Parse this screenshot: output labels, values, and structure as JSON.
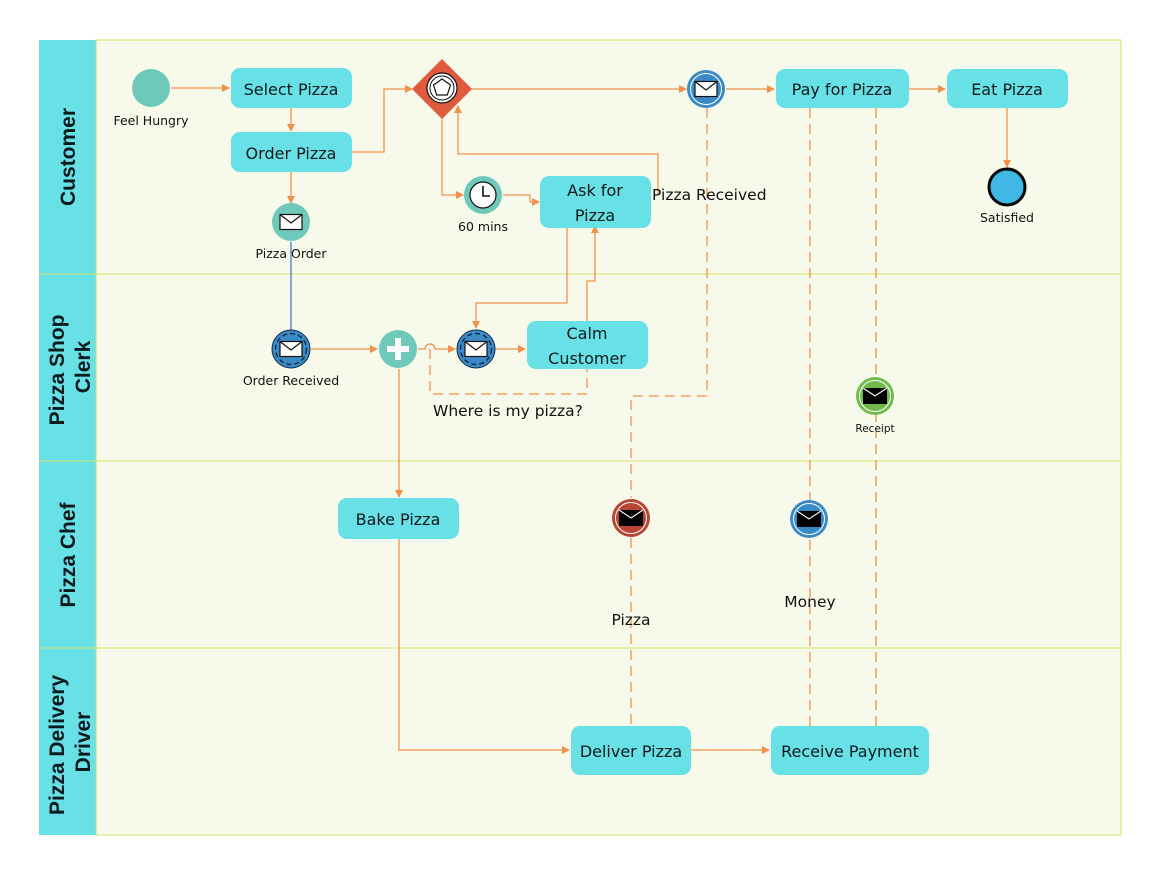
{
  "diagram": {
    "type": "BPMN swimlane",
    "lanes": [
      {
        "id": "customer",
        "label_lines": [
          "Customer"
        ]
      },
      {
        "id": "clerk",
        "label_lines": [
          "Pizza Shop",
          "Clerk"
        ]
      },
      {
        "id": "chef",
        "label_lines": [
          "Pizza Chef"
        ]
      },
      {
        "id": "driver",
        "label_lines": [
          "Pizza Delivery",
          "Driver"
        ]
      }
    ],
    "tasks": {
      "select_pizza": {
        "lines": [
          "Select Pizza"
        ]
      },
      "order_pizza": {
        "lines": [
          "Order Pizza"
        ]
      },
      "ask_for_pizza": {
        "lines": [
          "Ask for",
          "Pizza"
        ]
      },
      "pay_for_pizza": {
        "lines": [
          "Pay for Pizza"
        ]
      },
      "eat_pizza": {
        "lines": [
          "Eat Pizza"
        ]
      },
      "calm_customer": {
        "lines": [
          "Calm",
          "Customer"
        ]
      },
      "bake_pizza": {
        "lines": [
          "Bake Pizza"
        ]
      },
      "deliver_pizza": {
        "lines": [
          "Deliver Pizza"
        ]
      },
      "receive_payment": {
        "lines": [
          "Receive Payment"
        ]
      }
    },
    "events": {
      "feel_hungry": {
        "label": "Feel Hungry",
        "kind": "start",
        "color": "#6ec9bb"
      },
      "pizza_order": {
        "label": "Pizza Order",
        "kind": "message-throw",
        "color": "#6ec9bb"
      },
      "timer": {
        "label": "60 mins",
        "kind": "timer",
        "color": "#6ec9bb"
      },
      "pizza_received_msg": {
        "label": "",
        "kind": "message-intermediate",
        "color": "#3b8ac8"
      },
      "satisfied": {
        "label": "Satisfied",
        "kind": "end",
        "color": "#40b8e6"
      },
      "order_received": {
        "label": "Order Received",
        "kind": "message-start-noninterrupting",
        "color": "#3b8ac8"
      },
      "where_msg": {
        "label": "",
        "kind": "message-noninterrupting",
        "color": "#3b8ac8"
      },
      "receipt": {
        "label": "Receipt",
        "kind": "message",
        "color": "#72bb4a"
      },
      "pizza_msg": {
        "label": "",
        "kind": "message",
        "color": "#b84534"
      },
      "money_msg": {
        "label": "",
        "kind": "message",
        "color": "#3b8ac8"
      }
    },
    "gateways": {
      "event_gateway": {
        "kind": "event-based",
        "color": "#e05a3e"
      },
      "parallel_gateway": {
        "kind": "parallel",
        "color": "#6ec9bb"
      }
    },
    "flow_labels": {
      "pizza_received": "Pizza Received",
      "where_is_my_pizza": "Where is my pizza?",
      "pizza": "Pizza",
      "money": "Money"
    },
    "colors": {
      "task_fill": "#67e0e6",
      "lane_header": "#67e0e6",
      "lane_bg": "#f7f9ea",
      "flow": "#f2914a",
      "lane_separator": "#d4e46b"
    }
  }
}
